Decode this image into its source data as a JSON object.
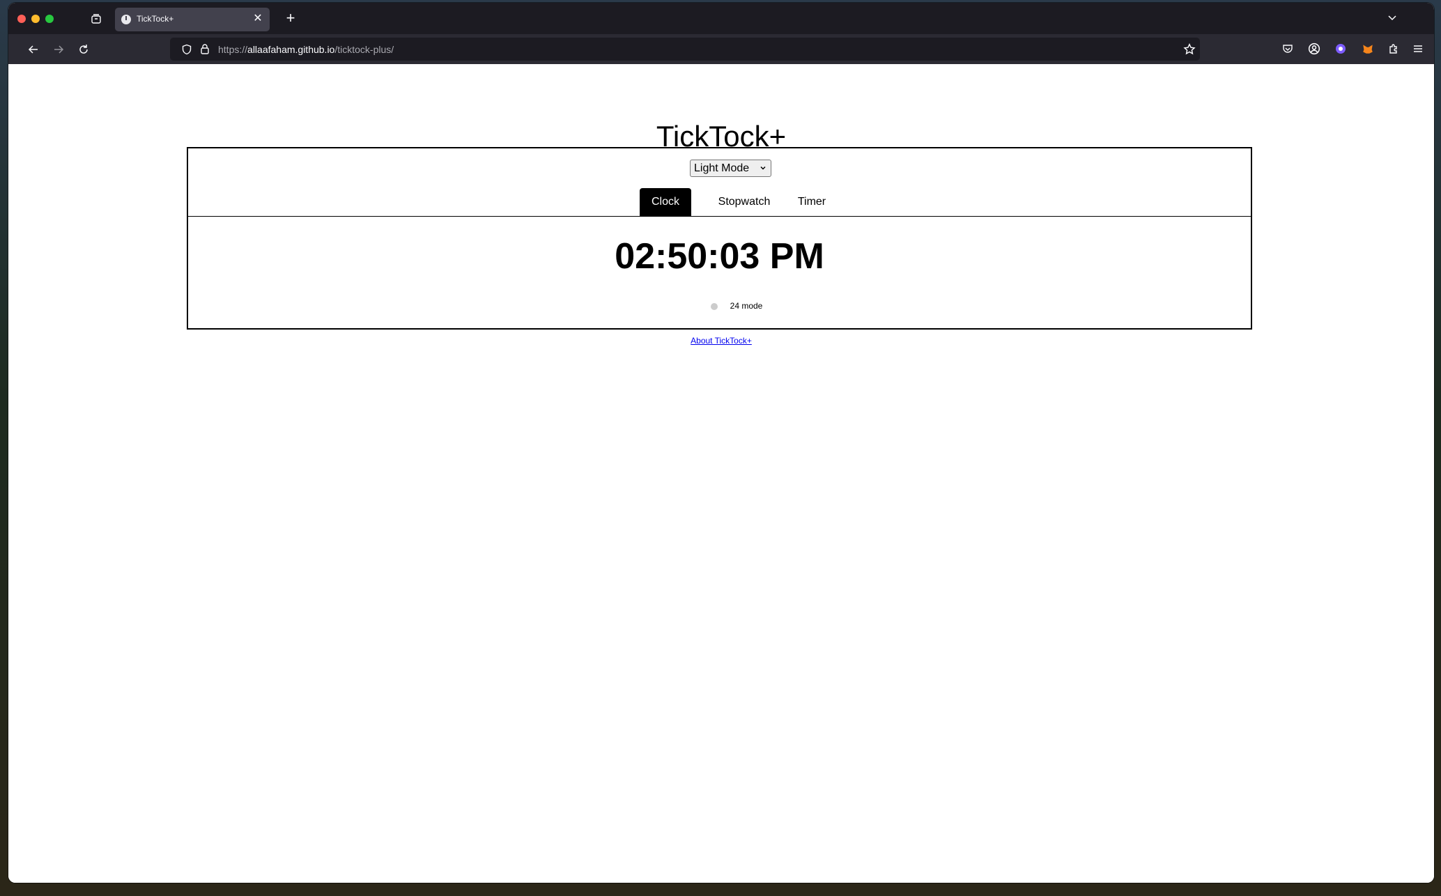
{
  "browser": {
    "tab_title": "TickTock+",
    "tab_close": "✕",
    "new_tab": "+",
    "url_scheme": "https://",
    "url_host": "allaafaham.github.io",
    "url_path": "/ticktock-plus/"
  },
  "app": {
    "title": "TickTock+",
    "theme_select": {
      "value": "Light Mode",
      "options": [
        "Light Mode"
      ]
    },
    "tabs": [
      {
        "label": "Clock",
        "active": true
      },
      {
        "label": "Stopwatch",
        "active": false
      },
      {
        "label": "Timer",
        "active": false
      }
    ],
    "clock": {
      "time": "02:50:03 PM",
      "toggle_label": "24 mode",
      "toggle_on": false
    },
    "about_link": "About TickTock+"
  },
  "colors": {
    "tab_active_bg": "#000000",
    "link": "#0000ee",
    "browser_bg": "#1c1b22",
    "navbar_bg": "#2b2a33"
  },
  "icons": [
    "tab-overview-icon",
    "back-arrow-icon",
    "forward-arrow-icon",
    "reload-icon",
    "shield-icon",
    "lock-icon",
    "bookmark-star-icon",
    "pocket-icon",
    "account-icon",
    "extension-icon",
    "metamask-icon",
    "extensions-puzzle-icon",
    "menu-icon",
    "tab-list-chevron-icon"
  ]
}
